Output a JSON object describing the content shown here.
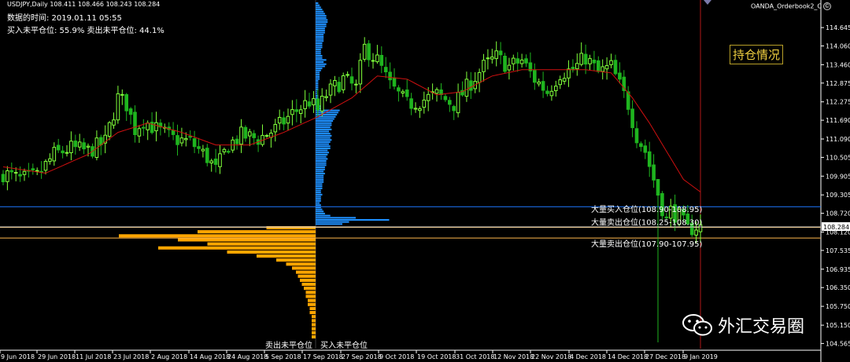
{
  "header": {
    "symbol_line": "USDJPY,Daily  108.411 108.466 108.243 108.284",
    "data_time": "数据的时间: 2019.01.11 05:55",
    "position_ratio": "买入未平仓位: 55.9%  卖出未平仓位: 44.1%"
  },
  "indicator": {
    "name": "OANDA_Orderbook2_C",
    "button_glyph": "©",
    "title": "持仓情况",
    "sell_label": "卖出未平仓位",
    "buy_label": "买入未平仓位"
  },
  "watermark": {
    "text": "外汇交易圈",
    "icon": "wechat-icon"
  },
  "colors": {
    "bull": "#7fff3a",
    "bear": "#1fb51f",
    "ma": "#d01010",
    "buy_bars": "#1e90ff",
    "sell_bars": "#ffa500",
    "buy_line": "#1e78ff",
    "sell_line": "#ffb84d",
    "price_line": "#d8d8d8"
  },
  "chart_data": {
    "type": "candlestick",
    "symbol": "USDJPY",
    "timeframe": "Daily",
    "last_price": "108.284",
    "ylim": [
      104.4,
      115.5
    ],
    "y_ticks": [
      "114.645",
      "114.060",
      "113.460",
      "112.875",
      "112.275",
      "111.690",
      "111.090",
      "110.505",
      "109.905",
      "109.305",
      "108.720",
      "108.120",
      "107.535",
      "106.935",
      "106.350",
      "105.750",
      "105.150",
      "104.565"
    ],
    "x_ticks": [
      "9 Jun 2018",
      "29 Jun 2018",
      "11 Jul 2018",
      "23 Jul 2018",
      "2 Aug 2018",
      "14 Aug 2018",
      "24 Aug 2018",
      "5 Sep 2018",
      "17 Sep 2018",
      "27 Sep 2018",
      "9 Oct 2018",
      "19 Oct 2018",
      "31 Oct 2018",
      "12 Nov 2018",
      "22 Nov 2018",
      "4 Dec 2018",
      "14 Dec 2018",
      "27 Dec 2018",
      "9 Jan 2019"
    ],
    "close_path": [
      [
        0,
        110.0
      ],
      [
        4,
        109.8
      ],
      [
        8,
        109.9
      ],
      [
        12,
        110.6
      ],
      [
        16,
        110.8
      ],
      [
        20,
        110.7
      ],
      [
        24,
        111.0
      ],
      [
        27,
        112.4
      ],
      [
        29,
        112.2
      ],
      [
        31,
        111.4
      ],
      [
        33,
        111.7
      ],
      [
        36,
        111.4
      ],
      [
        40,
        111.1
      ],
      [
        44,
        111.0
      ],
      [
        48,
        110.5
      ],
      [
        50,
        110.1
      ],
      [
        53,
        110.9
      ],
      [
        56,
        111.2
      ],
      [
        60,
        111.1
      ],
      [
        64,
        111.4
      ],
      [
        68,
        111.9
      ],
      [
        72,
        112.3
      ],
      [
        74,
        112.0
      ],
      [
        76,
        112.5
      ],
      [
        80,
        113.0
      ],
      [
        83,
        112.7
      ],
      [
        85,
        114.0
      ],
      [
        88,
        113.6
      ],
      [
        91,
        112.8
      ],
      [
        95,
        112.2
      ],
      [
        98,
        112.3
      ],
      [
        102,
        112.5
      ],
      [
        106,
        112.2
      ],
      [
        110,
        112.9
      ],
      [
        113,
        113.4
      ],
      [
        116,
        113.7
      ],
      [
        119,
        113.4
      ],
      [
        122,
        113.6
      ],
      [
        125,
        113.0
      ],
      [
        128,
        112.6
      ],
      [
        131,
        113.2
      ],
      [
        134,
        113.3
      ],
      [
        137,
        113.7
      ],
      [
        140,
        113.2
      ],
      [
        143,
        113.4
      ],
      [
        145,
        112.8
      ],
      [
        147,
        112.2
      ],
      [
        149,
        111.2
      ],
      [
        151,
        110.7
      ],
      [
        153,
        109.8
      ],
      [
        155,
        108.9
      ],
      [
        156,
        108.5
      ],
      [
        157,
        108.8
      ],
      [
        159,
        108.6
      ],
      [
        161,
        108.2
      ],
      [
        163,
        108.3
      ],
      [
        164,
        108.284
      ]
    ],
    "ma_path": [
      [
        0,
        110.2
      ],
      [
        10,
        110.0
      ],
      [
        20,
        110.6
      ],
      [
        27,
        111.3
      ],
      [
        34,
        111.6
      ],
      [
        42,
        111.3
      ],
      [
        50,
        110.9
      ],
      [
        58,
        110.9
      ],
      [
        66,
        111.3
      ],
      [
        74,
        111.8
      ],
      [
        82,
        112.4
      ],
      [
        88,
        113.1
      ],
      [
        95,
        113.0
      ],
      [
        102,
        112.5
      ],
      [
        108,
        112.6
      ],
      [
        115,
        113.1
      ],
      [
        122,
        113.3
      ],
      [
        130,
        113.3
      ],
      [
        137,
        113.3
      ],
      [
        143,
        113.2
      ],
      [
        148,
        112.4
      ],
      [
        152,
        111.6
      ],
      [
        156,
        110.7
      ],
      [
        160,
        109.8
      ],
      [
        164,
        109.4
      ]
    ],
    "events": [
      {
        "i": 154,
        "low": 104.6,
        "high": 109.6
      }
    ],
    "sell_histogram": [
      0.25,
      0.6,
      1.0,
      0.7,
      0.55,
      0.8,
      0.45,
      0.3,
      0.2,
      0.15,
      0.12,
      0.1,
      0.09,
      0.08,
      0.07,
      0.06,
      0.05,
      0.05,
      0.04,
      0.04,
      0.03,
      0.03,
      0.02,
      0.02,
      0.02,
      0.02,
      0.02,
      0.02
    ],
    "buy_histogram": [
      0.02,
      0.03,
      0.04,
      0.05,
      0.06,
      0.07,
      0.08,
      0.08,
      0.09,
      0.09,
      0.08,
      0.08,
      0.07,
      0.07,
      0.07,
      0.06,
      0.06,
      0.06,
      0.06,
      0.05,
      0.05,
      0.05,
      0.04,
      0.04,
      0.04,
      0.05,
      0.05,
      0.08,
      0.06,
      0.08,
      0.07,
      0.05,
      0.04,
      0.03,
      0.03,
      0.03,
      0.03,
      0.02,
      0.02,
      0.02,
      0.02,
      0.02,
      0.01,
      0.01,
      0.02,
      0.02,
      0.02,
      0.02,
      0.03,
      0.06,
      0.06,
      0.18,
      0.17,
      0.16,
      0.15,
      0.14,
      0.13,
      0.12,
      0.12,
      0.11,
      0.12,
      0.1,
      0.11,
      0.12,
      0.11,
      0.12,
      0.11,
      0.1,
      0.11,
      0.11,
      0.09,
      0.1,
      0.09,
      0.08,
      0.09,
      0.08,
      0.08,
      0.08,
      0.07,
      0.07,
      0.06,
      0.07,
      0.06,
      0.06,
      0.06,
      0.06,
      0.05,
      0.05,
      0.05,
      0.04,
      0.04,
      0.05,
      0.04,
      0.04,
      0.04,
      0.03,
      0.04,
      0.04,
      0.05,
      0.06,
      0.07,
      0.11,
      0.3,
      0.55,
      0.25,
      0.2
    ],
    "levels": [
      {
        "label": "大量买入仓位(108.90-108.95)",
        "price": 108.93,
        "kind": "buy"
      },
      {
        "label": "大量卖出仓位(108.25-108.30)",
        "price": 108.27,
        "kind": "sell"
      },
      {
        "label": "大量卖出仓位(107.90-107.95)",
        "price": 107.93,
        "kind": "sell"
      }
    ]
  }
}
